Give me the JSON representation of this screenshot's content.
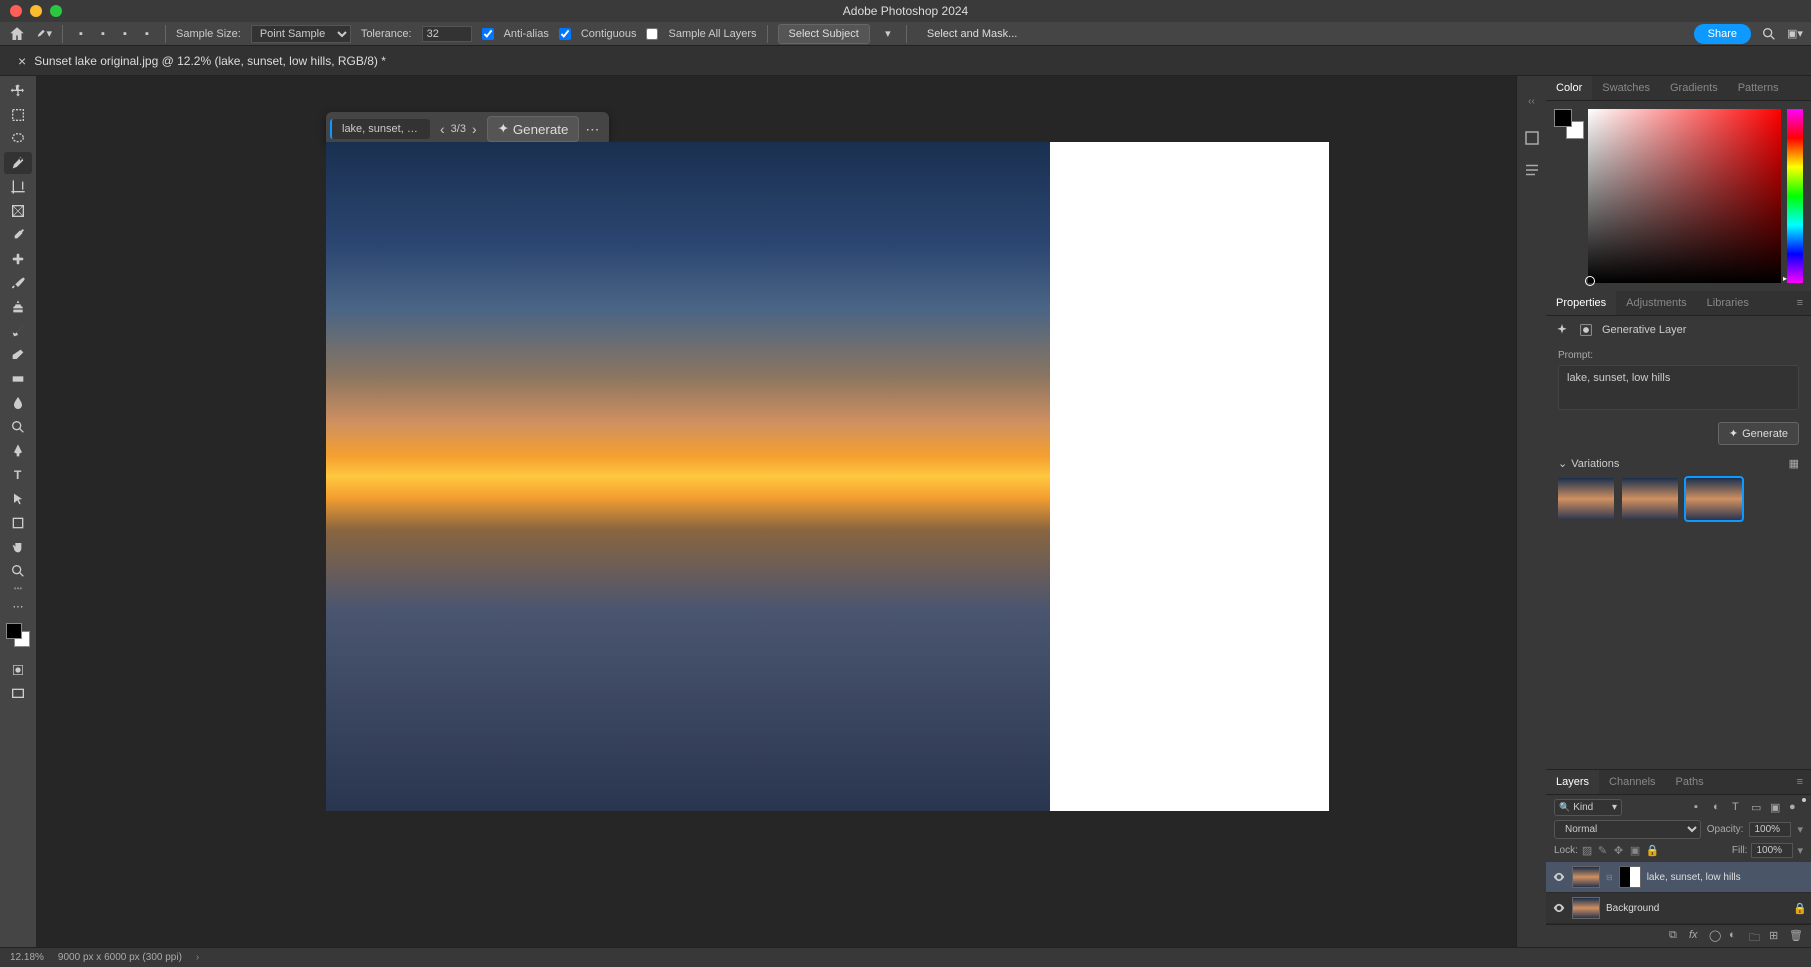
{
  "app": {
    "title": "Adobe Photoshop 2024"
  },
  "toolbar": {
    "sample_size_label": "Sample Size:",
    "sample_size_value": "Point Sample",
    "tolerance_label": "Tolerance:",
    "tolerance_value": "32",
    "anti_alias": "Anti-alias",
    "contiguous": "Contiguous",
    "sample_all": "Sample All Layers",
    "select_subject": "Select Subject",
    "select_and_mask": "Select and Mask...",
    "share": "Share"
  },
  "document": {
    "tab_title": "Sunset lake original.jpg @ 12.2% (lake, sunset, low hills, RGB/8) *"
  },
  "gen_bar": {
    "prompt": "lake, sunset, lo...",
    "counter": "3/3",
    "generate": "Generate"
  },
  "panels": {
    "color": {
      "tabs": [
        "Color",
        "Swatches",
        "Gradients",
        "Patterns"
      ]
    },
    "properties": {
      "tabs": [
        "Properties",
        "Adjustments",
        "Libraries"
      ],
      "layer_type": "Generative Layer",
      "prompt_label": "Prompt:",
      "prompt_value": "lake, sunset, low hills",
      "generate": "Generate",
      "variations": "Variations"
    },
    "layers": {
      "tabs": [
        "Layers",
        "Channels",
        "Paths"
      ],
      "kind": "Kind",
      "blend_mode": "Normal",
      "opacity_label": "Opacity:",
      "opacity_value": "100%",
      "lock_label": "Lock:",
      "fill_label": "Fill:",
      "fill_value": "100%",
      "items": [
        {
          "name": "lake, sunset, low hills"
        },
        {
          "name": "Background"
        }
      ]
    }
  },
  "status": {
    "zoom": "12.18%",
    "dims": "9000 px x 6000 px (300 ppi)"
  }
}
